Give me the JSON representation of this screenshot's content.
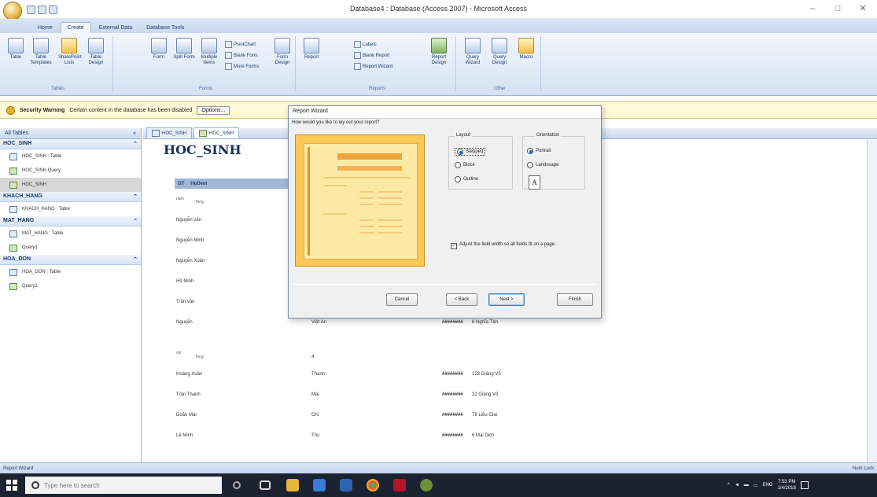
{
  "window": {
    "title": "Database4 : Database (Access 2007) - Microsoft Access",
    "controls": {
      "minimize": "–",
      "maximize": "□",
      "close": "✕"
    }
  },
  "ribbon": {
    "tabs": [
      "Home",
      "Create",
      "External Data",
      "Database Tools"
    ],
    "active_tab": "Create",
    "groups": {
      "tables": {
        "label": "Tables",
        "buttons": [
          "Table",
          "Table Templates",
          "SharePoint Lists",
          "Table Design"
        ]
      },
      "forms": {
        "label": "Forms",
        "buttons": [
          "Form",
          "Split Form",
          "Multiple Items"
        ],
        "small": [
          "PivotChart",
          "Blank Form",
          "More Forms"
        ],
        "design": "Form Design"
      },
      "reports": {
        "label": "Reports",
        "report": "Report",
        "small": [
          "Labels",
          "Blank Report",
          "Report Wizard"
        ],
        "design": "Report Design"
      },
      "other": {
        "label": "Other",
        "buttons": [
          "Query Wizard",
          "Query Design",
          "Macro"
        ]
      }
    }
  },
  "security_bar": {
    "label": "Security Warning",
    "message": "Certain content in the database has been disabled",
    "options_button": "Options..."
  },
  "nav_pane": {
    "header": "All Tables",
    "header_controls": "«",
    "groups": [
      {
        "name": "HOC_SINH",
        "items": [
          {
            "label": "HOC_SINH : Table",
            "type": "table"
          },
          {
            "label": "HOC_SINH Query",
            "type": "query"
          },
          {
            "label": "HOC_SINH",
            "type": "report",
            "selected": true
          }
        ]
      },
      {
        "name": "KHACH_HANG",
        "items": [
          {
            "label": "KHACH_HANG : Table",
            "type": "table"
          }
        ]
      },
      {
        "name": "MAT_HANG",
        "items": [
          {
            "label": "MAT_HANG : Table",
            "type": "table"
          },
          {
            "label": "Query1",
            "type": "query"
          }
        ]
      },
      {
        "name": "HOA_DON",
        "items": [
          {
            "label": "HOA_DON : Table",
            "type": "table"
          },
          {
            "label": "Query1",
            "type": "query"
          }
        ]
      }
    ]
  },
  "doc_tabs": [
    "HOC_SINH",
    "HOC_SINH"
  ],
  "report": {
    "title": "HOC_SINH",
    "header": [
      "GT",
      "HoDem"
    ],
    "group1_label": "nam",
    "group1_tong": "Tong",
    "group1_rows": [
      {
        "hodem": "Nguyễn văn"
      },
      {
        "hodem": "Nguyễn Minh"
      },
      {
        "hodem": "Nguyễn Xuân"
      },
      {
        "hodem": "Hồ Minh"
      },
      {
        "hodem": "Trần văn"
      },
      {
        "hodem": "Nguyễn",
        "ten": "Việt An",
        "date": "########",
        "addr": "6 Nghĩa Tân"
      }
    ],
    "group2_label": "nữ",
    "group2_tong": "Tong",
    "group2_count": "4",
    "group2_rows": [
      {
        "hodem": "Hoàng Xuân",
        "ten": "Thanh",
        "date": "########",
        "addr": "123 Giảng Võ"
      },
      {
        "hodem": "Trần Thanh",
        "ten": "Mai",
        "date": "########",
        "addr": "32 Giảng Võ"
      },
      {
        "hodem": "Doãn Mai",
        "ten": "Chi",
        "date": "########",
        "addr": "78 Liễu Giai"
      },
      {
        "hodem": "Lê Minh",
        "ten": "Thu",
        "date": "########",
        "addr": "6 Mai Dịch"
      }
    ]
  },
  "dialog": {
    "title": "Report Wizard",
    "question": "How would you like to lay out your report?",
    "layout_label": "Layout",
    "layout_options": [
      "Stepped",
      "Block",
      "Outline"
    ],
    "layout_selected": "Stepped",
    "orientation_label": "Orientation",
    "orientation_options": [
      "Portrait",
      "Landscape"
    ],
    "orientation_selected": "Portrait",
    "orientation_icon": "A",
    "adjust_text": "Adjust the field width so all fields fit on a page.",
    "adjust_checked": true,
    "buttons": {
      "cancel": "Cancel",
      "back": "< Back",
      "next": "Next >",
      "finish": "Finish"
    }
  },
  "status_bar": {
    "left": "Report Wizard",
    "right": "Num Lock"
  },
  "taskbar": {
    "search_placeholder": "Type here to search",
    "language": "ENG",
    "time": "7:53 PM",
    "date": "1/4/2018"
  },
  "colors": {
    "ribbon_accent": "#c9d9ef",
    "report_title": "#1a2f55",
    "wizard_preview": "#fbc853",
    "taskbar": "#1b2230"
  }
}
